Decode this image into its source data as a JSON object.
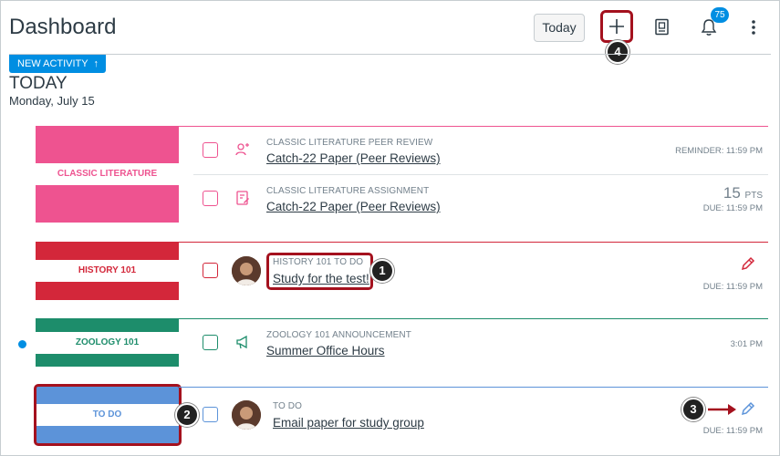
{
  "header": {
    "title": "Dashboard",
    "today_button": "Today",
    "notification_count": "75",
    "icons": {
      "add": "plus-icon",
      "grades": "grades-icon",
      "notifications": "bell-icon",
      "menu": "kebab-menu-icon"
    }
  },
  "activity": {
    "new_activity_label": "NEW ACTIVITY",
    "day": "TODAY",
    "date": "Monday, July 15"
  },
  "callouts": [
    "1",
    "2",
    "3",
    "4"
  ],
  "groups": [
    {
      "course": "CLASSIC LITERATURE",
      "color": "#ee5390",
      "items": [
        {
          "kicker": "CLASSIC LITERATURE PEER REVIEW",
          "title": "Catch-22 Paper (Peer Reviews)",
          "due": "REMINDER: 11:59 PM",
          "icon": "peer-review-icon"
        },
        {
          "kicker": "CLASSIC LITERATURE ASSIGNMENT",
          "title": "Catch-22 Paper (Peer Reviews)",
          "points": "15",
          "points_unit": "PTS",
          "due": "DUE: 11:59 PM",
          "icon": "assignment-icon"
        }
      ]
    },
    {
      "course": "HISTORY 101",
      "color": "#d3273a",
      "items": [
        {
          "kicker": "HISTORY 101 TO DO",
          "title": "Study for the test!",
          "due": "DUE: 11:59 PM",
          "icon": "edit-pencil-icon"
        }
      ]
    },
    {
      "course": "ZOOLOGY 101",
      "color": "#1d8d6b",
      "items": [
        {
          "kicker": "ZOOLOGY 101 ANNOUNCEMENT",
          "title": "Summer Office Hours",
          "due": "3:01 PM",
          "icon": "announcement-icon"
        }
      ]
    },
    {
      "course": "TO DO",
      "color": "#5c93d9",
      "items": [
        {
          "kicker": "TO DO",
          "title": "Email paper for study group",
          "due": "DUE: 11:59 PM",
          "icon": "edit-pencil-icon"
        }
      ]
    }
  ]
}
